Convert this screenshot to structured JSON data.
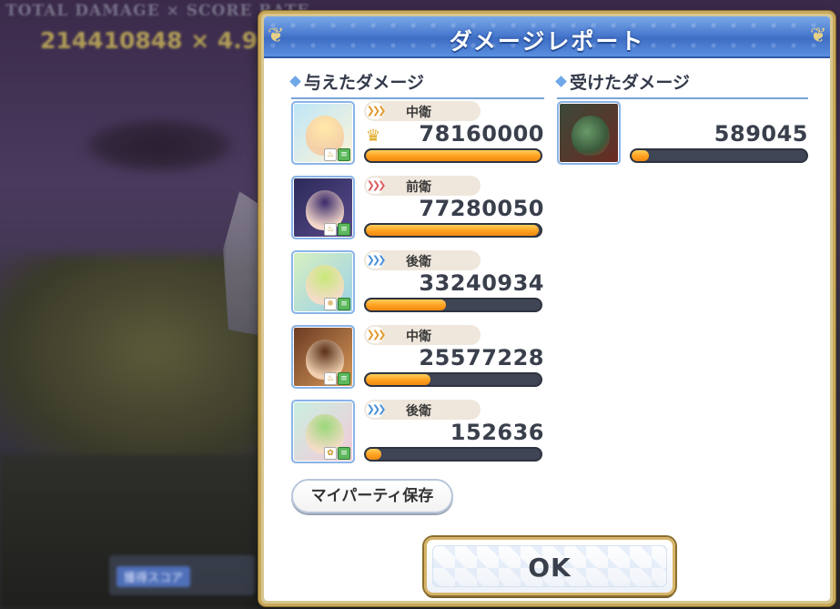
{
  "background": {
    "score_header": "TOTAL DAMAGE × SCORE RATE",
    "score_value": "214410848 × 4.9",
    "held_score_label": "獲得スコア"
  },
  "dialog": {
    "title": "ダメージレポート",
    "dealt": {
      "heading": "与えたダメージ",
      "rows": [
        {
          "position": "中衛",
          "damage": "78160000",
          "fill": 1.0,
          "crown": true,
          "element": "fire"
        },
        {
          "position": "前衛",
          "damage": "77280050",
          "fill": 0.99,
          "crown": false,
          "element": "fire"
        },
        {
          "position": "後衛",
          "damage": "33240934",
          "fill": 0.46,
          "crown": false,
          "element": "water"
        },
        {
          "position": "中衛",
          "damage": "25577228",
          "fill": 0.37,
          "crown": false,
          "element": "fire"
        },
        {
          "position": "後衛",
          "damage": "152636",
          "fill": 0.09,
          "crown": false,
          "element": "wind"
        }
      ]
    },
    "received": {
      "heading": "受けたダメージ",
      "rows": [
        {
          "damage": "589045",
          "fill": 0.1
        }
      ]
    },
    "save_party_label": "マイパーティ保存",
    "ok_label": "OK"
  },
  "colors": {
    "title_bar": "#4a7bd0",
    "bar_fill": "#ffa020",
    "bar_track": "#3f4554",
    "frame_gold": "#c8a85a"
  }
}
